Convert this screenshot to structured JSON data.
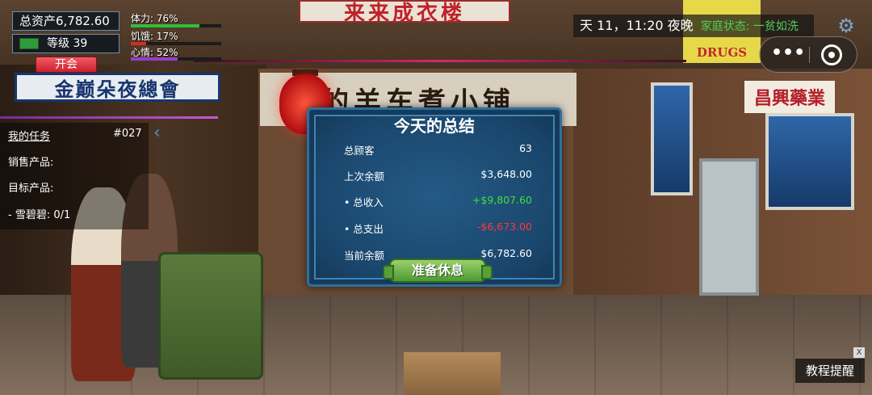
{
  "hud": {
    "total_assets": "总资产6,782.60",
    "level": "等级 39",
    "meeting_button": "开会",
    "stats": [
      {
        "label": "体力: 76%",
        "value": 0.76,
        "color": "#2fbf3a"
      },
      {
        "label": "饥饿: 17%",
        "value": 0.17,
        "color": "#d62a2a"
      },
      {
        "label": "心情: 52%",
        "value": 0.52,
        "color": "#9a3ad0"
      }
    ]
  },
  "clock": {
    "time": "天 11，11:20 夜晚",
    "family_status": "家庭状态: 一贫如洗"
  },
  "task_panel": {
    "title": "我的任务",
    "number": "#027",
    "sell_label": "销售产品:",
    "target_label": "目标产品:",
    "target_item": "- 雪碧碧: 0/1"
  },
  "summary": {
    "title": "今天的总结",
    "rows": [
      {
        "label": "总顾客",
        "value": "63"
      },
      {
        "label": "上次余额",
        "value": "$3,648.00"
      },
      {
        "label": "• 总收入",
        "value": "+$9,807.60"
      },
      {
        "label": "• 总支出",
        "value": "-$6,673.00"
      },
      {
        "label": "当前余额",
        "value": "$6,782.60"
      }
    ],
    "rest_button": "准备休息"
  },
  "tutorial_button": "教程提醒",
  "tutorial_close": "X",
  "scene_text": {
    "sign_top": "来来成衣楼",
    "sign_left": "金巅朵夜總會",
    "sign_shop": "的羊车煮小铺",
    "sign_right": "昌興藥業",
    "sign_drugs": "DRUGS"
  },
  "colors": {
    "income": "#3fe03a",
    "expense": "#ff3838",
    "family_status": "#4fd05a"
  }
}
